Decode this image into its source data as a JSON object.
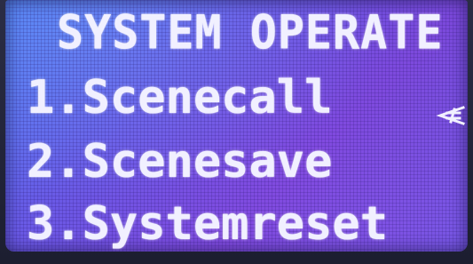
{
  "display": {
    "title": "SYSTEM OPERATE",
    "menu": [
      {
        "number": "1.",
        "label": "Scenecall",
        "selected": true
      },
      {
        "number": "2.",
        "label": "Scenesave",
        "selected": false
      },
      {
        "number": "3.",
        "label": "Systemreset",
        "selected": false
      }
    ],
    "cursor_icon": "selection-pointer-icon",
    "colors": {
      "text": "#f1f0ff",
      "screen_blue": "#4d7cf2",
      "screen_violet": "#7b49dc"
    }
  }
}
